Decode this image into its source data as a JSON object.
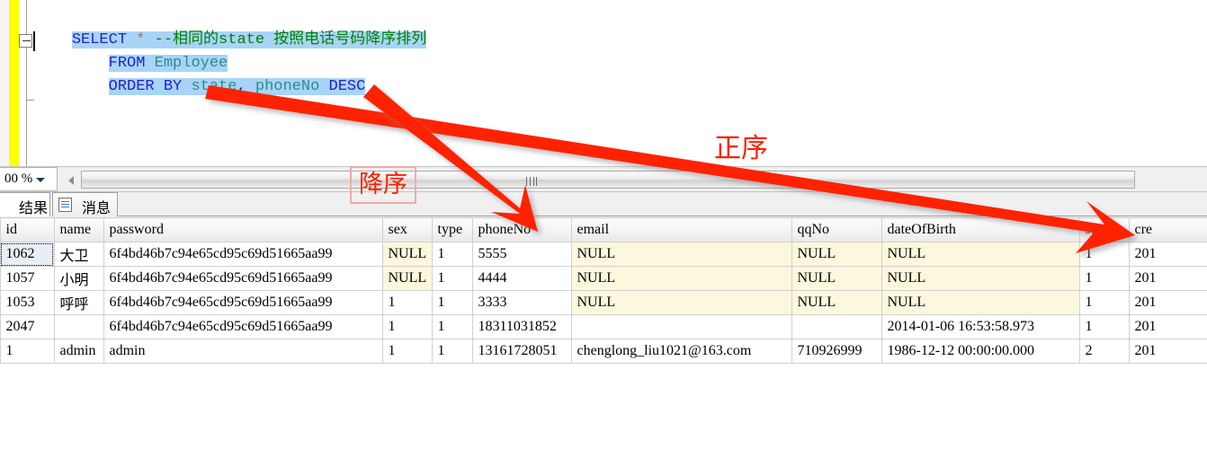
{
  "editor": {
    "zoom_level": "00 %",
    "collapse_marker": "-",
    "sql_lines": [
      {
        "indent": "    ",
        "parts": [
          {
            "t": "SELECT ",
            "c": "kw"
          },
          {
            "t": "* ",
            "c": "star"
          },
          {
            "t": "--相同的state 按照电话号码降序排列",
            "c": "cmt"
          }
        ]
      },
      {
        "indent": "        ",
        "parts": [
          {
            "t": "FROM ",
            "c": "kw"
          },
          {
            "t": "Employee",
            "c": "tbl"
          }
        ]
      },
      {
        "indent": "        ",
        "parts": [
          {
            "t": "ORDER BY ",
            "c": "kw"
          },
          {
            "t": "state",
            "c": "ident"
          },
          {
            "t": ", ",
            "c": "kw"
          },
          {
            "t": "phoneNo ",
            "c": "ident"
          },
          {
            "t": "DESC",
            "c": "kw"
          }
        ]
      }
    ]
  },
  "tabs": {
    "results_label": "结果",
    "messages_label": "消息",
    "active": "结果"
  },
  "grid": {
    "columns": [
      "",
      "id",
      "name",
      "password",
      "sex",
      "type",
      "phoneNo",
      "email",
      "qqNo",
      "dateOfBirth",
      "state",
      "cre"
    ],
    "rows": [
      {
        "cells": [
          "",
          "1062",
          "大卫",
          "6f4bd46b7c94e65cd95c69d51665aa99",
          "NULL",
          "1",
          "5555",
          "NULL",
          "NULL",
          "NULL",
          "1",
          "201"
        ],
        "nulls": [
          4,
          7,
          8,
          9
        ],
        "focused": 1
      },
      {
        "cells": [
          "",
          "1057",
          "小明",
          "6f4bd46b7c94e65cd95c69d51665aa99",
          "NULL",
          "1",
          "4444",
          "NULL",
          "NULL",
          "NULL",
          "1",
          "201"
        ],
        "nulls": [
          4,
          7,
          8,
          9
        ],
        "focused": -1
      },
      {
        "cells": [
          "",
          "1053",
          "呼呼",
          "6f4bd46b7c94e65cd95c69d51665aa99",
          "1",
          "1",
          "3333",
          "NULL",
          "NULL",
          "NULL",
          "1",
          "201"
        ],
        "nulls": [
          7,
          8,
          9
        ],
        "focused": -1
      },
      {
        "cells": [
          "",
          "2047",
          "",
          "6f4bd46b7c94e65cd95c69d51665aa99",
          "1",
          "1",
          "18311031852",
          "",
          "",
          "2014-01-06 16:53:58.973",
          "1",
          "201"
        ],
        "nulls": [],
        "focused": -1
      },
      {
        "cells": [
          "",
          "1",
          "admin",
          "admin",
          "1",
          "1",
          "13161728051",
          "chenglong_liu1021@163.com",
          "710926999",
          "1986-12-12 00:00:00.000",
          "2",
          "201"
        ],
        "nulls": [],
        "focused": -1
      }
    ]
  },
  "annotations": {
    "descending_label": "降序",
    "ascending_label": "正序",
    "arrow_color": "#ff2000",
    "box_border_color": "#f3a9a9"
  }
}
